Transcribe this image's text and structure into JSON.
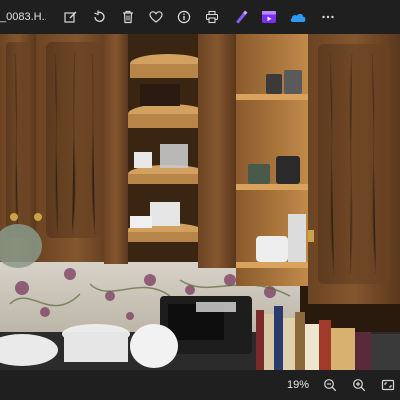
{
  "window": {
    "title": "_0083.H..."
  },
  "toolbar": {
    "buttons": [
      {
        "name": "edit-image-icon"
      },
      {
        "name": "rotate-icon"
      },
      {
        "name": "delete-icon"
      },
      {
        "name": "favorite-icon"
      },
      {
        "name": "info-icon"
      },
      {
        "name": "print-icon"
      },
      {
        "name": "designer-icon"
      },
      {
        "name": "clipchamp-icon"
      },
      {
        "name": "onedrive-icon"
      },
      {
        "name": "more-options-icon"
      }
    ]
  },
  "statusbar": {
    "zoom_value": "19%",
    "buttons": [
      {
        "name": "zoom-out-icon"
      },
      {
        "name": "zoom-in-icon"
      },
      {
        "name": "fit-to-window-icon"
      }
    ]
  },
  "colors": {
    "toolbar_bg": "#1f1f1f",
    "icon": "#d8d8d8",
    "designer_accent": "#8a5cf6",
    "clipchamp_accent": "#7b2ff7",
    "onedrive_accent": "#2f9bf0"
  }
}
